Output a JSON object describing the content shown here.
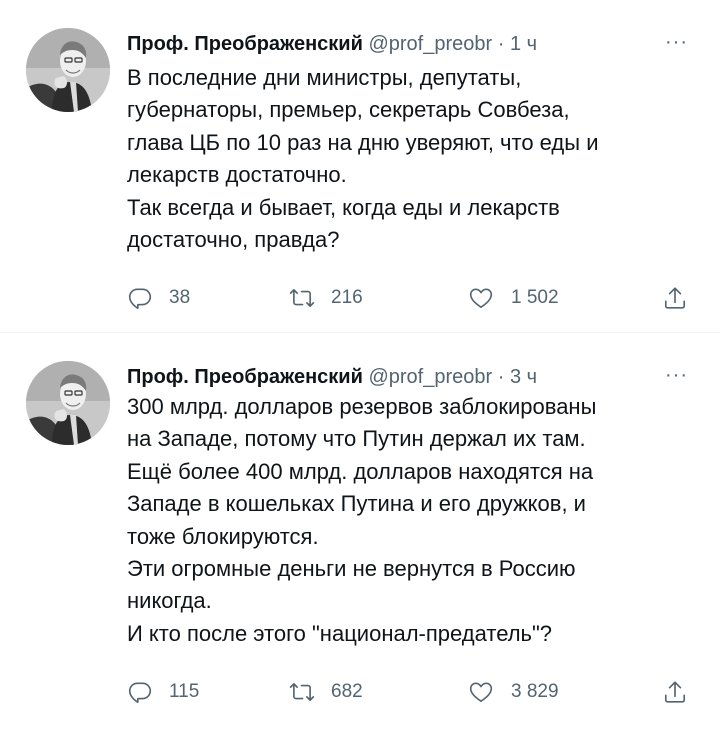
{
  "tweets": [
    {
      "author": {
        "name": "Проф. Преображенский",
        "handle": "@prof_preobr"
      },
      "separator": "·",
      "time": "1 ч",
      "more": "···",
      "lines": [
        "В последние дни министры, депутаты,",
        "губернаторы, премьер, секретарь Совбеза,",
        "глава ЦБ по 10 раз на дню уверяют, что еды и",
        "лекарств достаточно.",
        "Так всегда и бывает, когда еды и лекарств",
        "достаточно, правда?"
      ],
      "actions": {
        "replies": "38",
        "retweets": "216",
        "likes": "1 502"
      }
    },
    {
      "author": {
        "name": "Проф. Преображенский",
        "handle": "@prof_preobr"
      },
      "separator": "·",
      "time": "3 ч",
      "more": "···",
      "lines": [
        "300 млрд. долларов резервов заблокированы",
        "на Западе, потому что Путин держал их там.",
        "Ещё более 400 млрд. долларов находятся на",
        "Западе в кошельках Путина и его дружков, и",
        "тоже блокируются.",
        "Эти огромные деньги не вернутся в Россию",
        "никогда.",
        "И кто после этого \"национал-предатель\"?"
      ],
      "actions": {
        "replies": "115",
        "retweets": "682",
        "likes": "3 829"
      }
    }
  ],
  "icons": {
    "reply": "reply-icon",
    "retweet": "retweet-icon",
    "like": "heart-icon",
    "share": "share-icon",
    "more": "more-icon"
  },
  "colors": {
    "text": "#0f1419",
    "secondary": "#536471",
    "divider": "#eff3f4"
  }
}
